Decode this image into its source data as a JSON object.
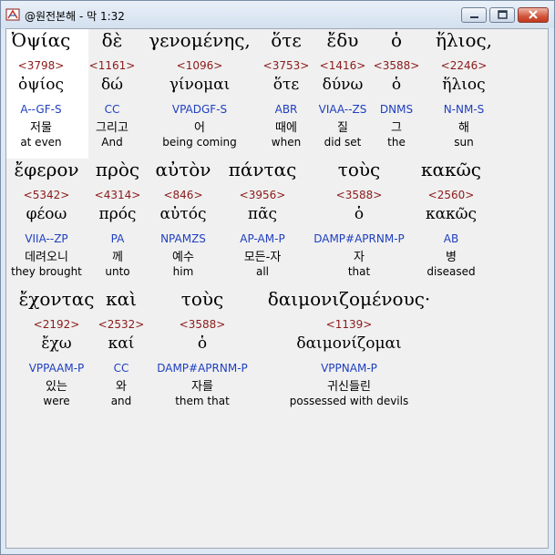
{
  "window": {
    "title": "@원전본해 - 막 1:32",
    "icon": "app-book-icon",
    "controls": [
      "minimize",
      "maximize",
      "close"
    ]
  },
  "rows": [
    {
      "words": [
        {
          "greek": "Ὀψίας",
          "strong": "<3798>",
          "lemma": "ὀψίος",
          "parse": "A--GF-S",
          "korean": "저물",
          "english": "at even"
        },
        {
          "greek": "δὲ",
          "strong": "<1161>",
          "lemma": "δώ",
          "parse": "CC",
          "korean": "그리고",
          "english": "And"
        },
        {
          "greek": "γενομένης,",
          "strong": "<1096>",
          "lemma": "γίνομαι",
          "parse": "VPADGF-S",
          "korean": "어",
          "english": "being coming"
        },
        {
          "greek": "ὅτε",
          "strong": "<3753>",
          "lemma": "ὅτε",
          "parse": "ABR",
          "korean": "때에",
          "english": "when"
        },
        {
          "greek": "ἔδυ",
          "strong": "<1416>",
          "lemma": "δύνω",
          "parse": "VIAA--ZS",
          "korean": "질",
          "english": "did set"
        },
        {
          "greek": "ὁ",
          "strong": "<3588>",
          "lemma": "ὁ",
          "parse": "DNMS",
          "korean": "그",
          "english": "the"
        },
        {
          "greek": "ἥλιος,",
          "strong": "<2246>",
          "lemma": "ἥλιος",
          "parse": "N-NM-S",
          "korean": "해",
          "english": "sun"
        }
      ]
    },
    {
      "words": [
        {
          "greek": "ἔφερον",
          "strong": "<5342>",
          "lemma": "φέοω",
          "parse": "VIIA--ZP",
          "korean": "데려오니",
          "english": "they brought"
        },
        {
          "greek": "πρὸς",
          "strong": "<4314>",
          "lemma": "πρός",
          "parse": "PA",
          "korean": "께",
          "english": "unto"
        },
        {
          "greek": "αὐτὸν",
          "strong": "<846>",
          "lemma": "αὐτός",
          "parse": "NPAMZS",
          "korean": "예수",
          "english": "him"
        },
        {
          "greek": "πάντας",
          "strong": "<3956>",
          "lemma": "πᾶς",
          "parse": "AP-AM-P",
          "korean": "모든-자",
          "english": "all"
        },
        {
          "greek": "τοὺς",
          "strong": "<3588>",
          "lemma": "ὁ",
          "parse": "DAMP#APRNM-P",
          "korean": "자",
          "english": "that"
        },
        {
          "greek": "κακῶς",
          "strong": "<2560>",
          "lemma": "κακῶς",
          "parse": "AB",
          "korean": "병",
          "english": "diseased"
        }
      ]
    },
    {
      "words": [
        {
          "greek": "ἔχοντας",
          "strong": "<2192>",
          "lemma": "ἔχω",
          "parse": "VPPAAM-P",
          "korean": "있는",
          "english": "were"
        },
        {
          "greek": "καὶ",
          "strong": "<2532>",
          "lemma": "καί",
          "parse": "CC",
          "korean": "와",
          "english": "and"
        },
        {
          "greek": "τοὺς",
          "strong": "<3588>",
          "lemma": "ὁ",
          "parse": "DAMP#APRNM-P",
          "korean": "자를",
          "english": "them that"
        },
        {
          "greek": "δαιμονιζομένους·",
          "strong": "<1139>",
          "lemma": "δαιμονίζομαι",
          "parse": "VPPNAM-P",
          "korean": "귀신들린",
          "english": "possessed with devils"
        }
      ]
    }
  ]
}
